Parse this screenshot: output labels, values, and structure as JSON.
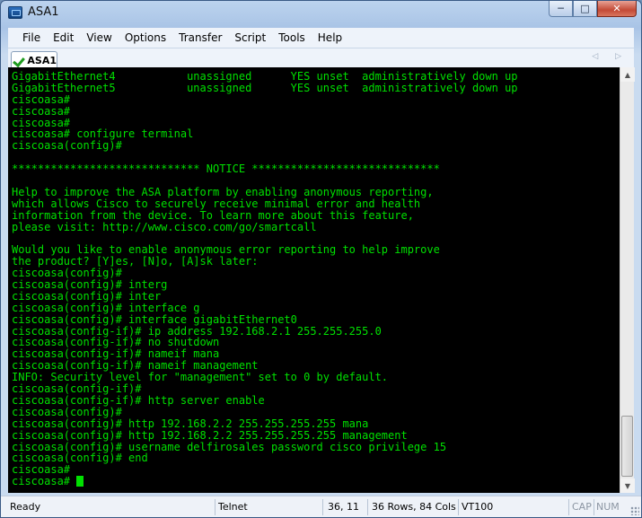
{
  "window": {
    "title": "ASA1",
    "buttons": {
      "minimize": "─",
      "maximize": "□",
      "close": "✕"
    }
  },
  "menu": [
    "File",
    "Edit",
    "View",
    "Options",
    "Transfer",
    "Script",
    "Tools",
    "Help"
  ],
  "tab": {
    "label": "ASA1",
    "arrows": "◁ ▷"
  },
  "terminal": {
    "lines": [
      "GigabitEthernet4           unassigned      YES unset  administratively down up",
      "GigabitEthernet5           unassigned      YES unset  administratively down up",
      "ciscoasa#",
      "ciscoasa#",
      "ciscoasa#",
      "ciscoasa# configure terminal",
      "ciscoasa(config)#",
      "",
      "***************************** NOTICE *****************************",
      "",
      "Help to improve the ASA platform by enabling anonymous reporting,",
      "which allows Cisco to securely receive minimal error and health",
      "information from the device. To learn more about this feature,",
      "please visit: http://www.cisco.com/go/smartcall",
      "",
      "Would you like to enable anonymous error reporting to help improve",
      "the product? [Y]es, [N]o, [A]sk later:",
      "ciscoasa(config)#",
      "ciscoasa(config)# interg",
      "ciscoasa(config)# inter",
      "ciscoasa(config)# interface g",
      "ciscoasa(config)# interface gigabitEthernet0",
      "ciscoasa(config-if)# ip address 192.168.2.1 255.255.255.0",
      "ciscoasa(config-if)# no shutdown",
      "ciscoasa(config-if)# nameif mana",
      "ciscoasa(config-if)# nameif management",
      "INFO: Security level for \"management\" set to 0 by default.",
      "ciscoasa(config-if)#",
      "ciscoasa(config-if)# http server enable",
      "ciscoasa(config)#",
      "ciscoasa(config)# http 192.168.2.2 255.255.255.255 mana",
      "ciscoasa(config)# http 192.168.2.2 255.255.255.255 management",
      "ciscoasa(config)# username delfirosales password cisco privilege 15",
      "ciscoasa(config)# end",
      "ciscoasa#"
    ],
    "prompt": "ciscoasa# "
  },
  "status": {
    "state": "Ready",
    "protocol": "Telnet",
    "position": "36, 11",
    "size": "36 Rows, 84 Cols",
    "emulation": "VT100",
    "cap": "CAP",
    "num": "NUM"
  },
  "colors": {
    "terminal_bg": "#000000",
    "terminal_fg": "#00e000"
  }
}
